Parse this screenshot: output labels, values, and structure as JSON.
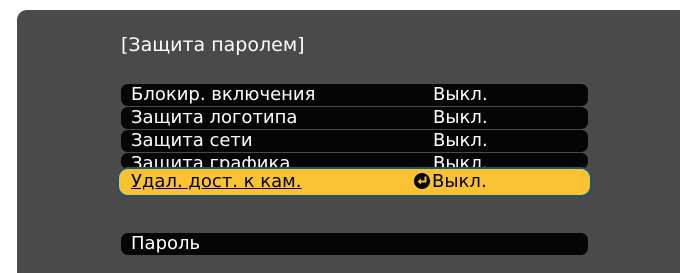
{
  "screen": {
    "title": "[Защита паролем]",
    "items": [
      {
        "label": "Блокир. включения",
        "value": "Выкл."
      },
      {
        "label": "Защита логотипа",
        "value": "Выкл."
      },
      {
        "label": "Защита сети",
        "value": "Выкл."
      },
      {
        "label": "Защита графика",
        "value": "Выкл."
      },
      {
        "label": "Удал. дост. к кам.",
        "value": "Выкл.",
        "selected": true
      },
      {
        "label": "Пароль",
        "value": ""
      }
    ]
  },
  "colors": {
    "panel_bg": "#4a4a4a",
    "item_bg": "#050505",
    "selected_bg": "#f8c233",
    "selected_border": "#16577a"
  },
  "icons": {
    "selected_value_marker": "circle-arrow-icon"
  }
}
